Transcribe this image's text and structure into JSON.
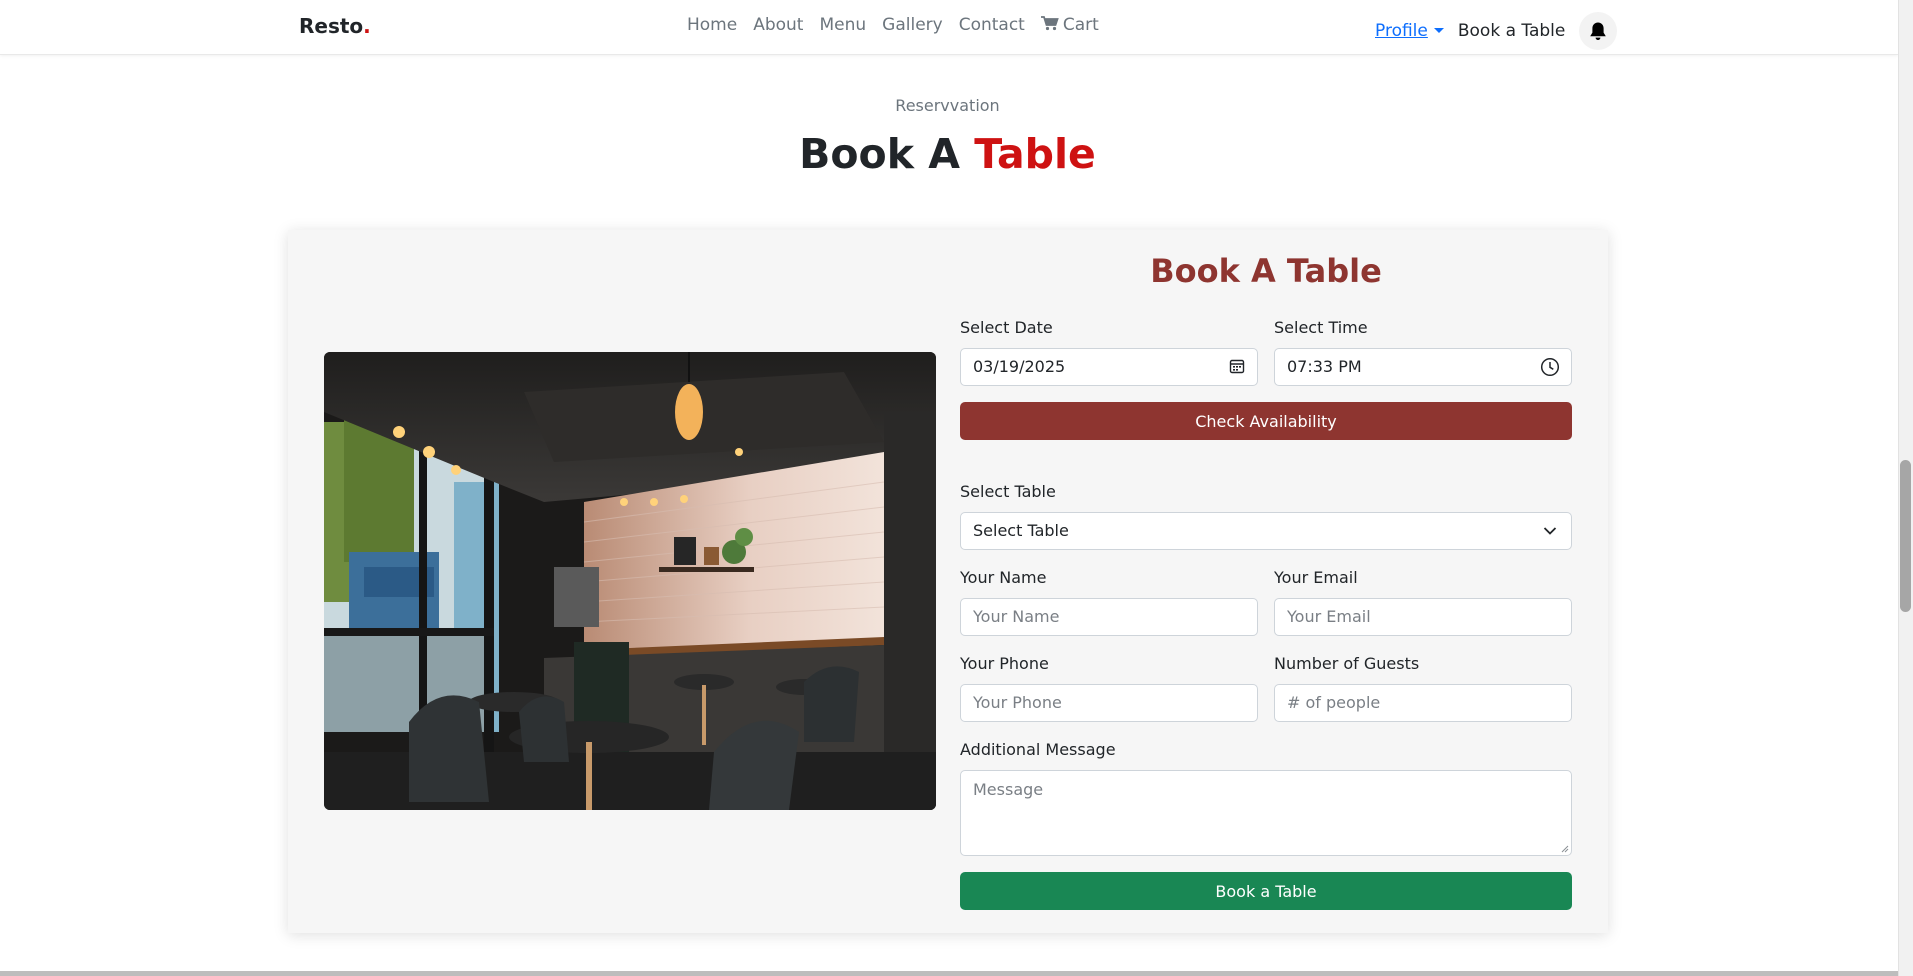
{
  "nav": {
    "brand": "Resto",
    "brand_dot": ".",
    "links": [
      "Home",
      "About",
      "Menu",
      "Gallery",
      "Contact"
    ],
    "cart": "Cart",
    "profile": "Profile",
    "book_link": "Book a Table"
  },
  "section": {
    "subtitle": "Reservvation",
    "title_main": "Book A ",
    "title_accent": "Table"
  },
  "form": {
    "title": "Book A Table",
    "date_label": "Select Date",
    "date_value": "03/19/2025",
    "time_label": "Select Time",
    "time_value": "07:33 PM",
    "check_button": "Check Availability",
    "table_label": "Select Table",
    "table_value": "Select Table",
    "name_label": "Your Name",
    "name_placeholder": "Your Name",
    "email_label": "Your Email",
    "email_placeholder": "Your Email",
    "phone_label": "Your Phone",
    "phone_placeholder": "Your Phone",
    "guests_label": "Number of Guests",
    "guests_placeholder": "# of people",
    "message_label": "Additional Message",
    "message_placeholder": "Message",
    "submit_button": "Book a Table"
  },
  "colors": {
    "accent": "#ce1212",
    "form_title": "#8e3530",
    "check_button": "#8e3530",
    "submit_button": "#198754",
    "link": "#0d6efd"
  }
}
